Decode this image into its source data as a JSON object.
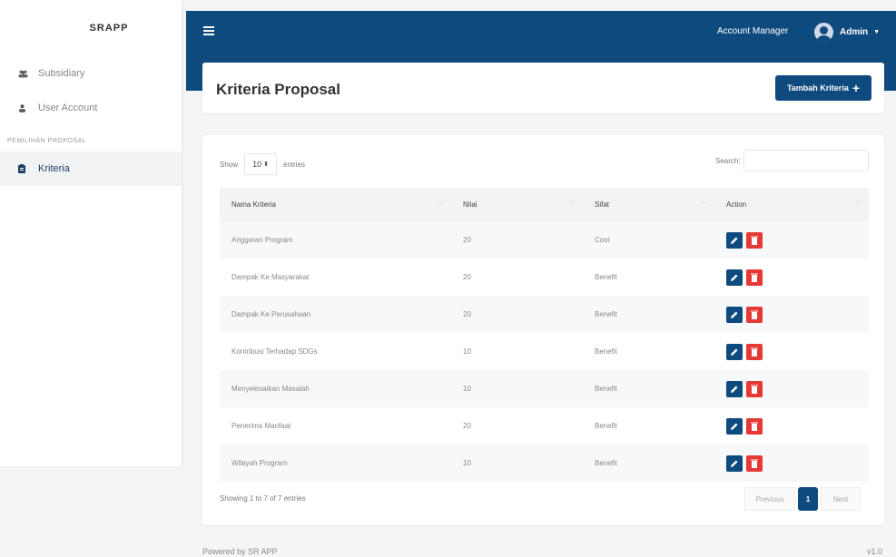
{
  "app": {
    "brand": "SRAPP"
  },
  "sidebar": {
    "items": [
      {
        "label": "Subsidiary",
        "icon": "users-icon"
      },
      {
        "label": "User Account",
        "icon": "user-icon"
      }
    ],
    "section_label": "PEMILIHAN PROPOSAL",
    "section_items": [
      {
        "label": "Kriteria",
        "icon": "clipboard-icon",
        "active": true
      }
    ]
  },
  "topbar": {
    "account_label": "Account Manager",
    "user_label": "Admin"
  },
  "header": {
    "title": "Kriteria Proposal",
    "add_button": "Tambah Kriteria"
  },
  "table_controls": {
    "show_label": "Show",
    "entries_value": "10",
    "entries_label": "entries",
    "search_label": "Search:",
    "search_value": ""
  },
  "table": {
    "columns": [
      "Nama Kriteria",
      "Nilai",
      "Sifat",
      "Action"
    ],
    "rows": [
      {
        "nama": "Anggaran Program",
        "nilai": "20",
        "sifat": "Cost"
      },
      {
        "nama": "Dampak Ke Masyarakat",
        "nilai": "20",
        "sifat": "Benefit"
      },
      {
        "nama": "Dampak Ke Perusahaan",
        "nilai": "20",
        "sifat": "Benefit"
      },
      {
        "nama": "Kontribusi Terhadap SDGs",
        "nilai": "10",
        "sifat": "Benefit"
      },
      {
        "nama": "Menyelesaikan Masalah",
        "nilai": "10",
        "sifat": "Benefit"
      },
      {
        "nama": "Penerima Manfaat",
        "nilai": "20",
        "sifat": "Benefit"
      },
      {
        "nama": "Wilayah Program",
        "nilai": "10",
        "sifat": "Benefit"
      }
    ]
  },
  "pagination": {
    "info": "Showing 1 to 7 of 7 entries",
    "previous": "Previous",
    "current": "1",
    "next": "Next"
  },
  "footer": {
    "left": "Powered by SR APP",
    "right": "v1.0"
  },
  "colors": {
    "primary": "#0f4a7e",
    "danger": "#e53935"
  }
}
